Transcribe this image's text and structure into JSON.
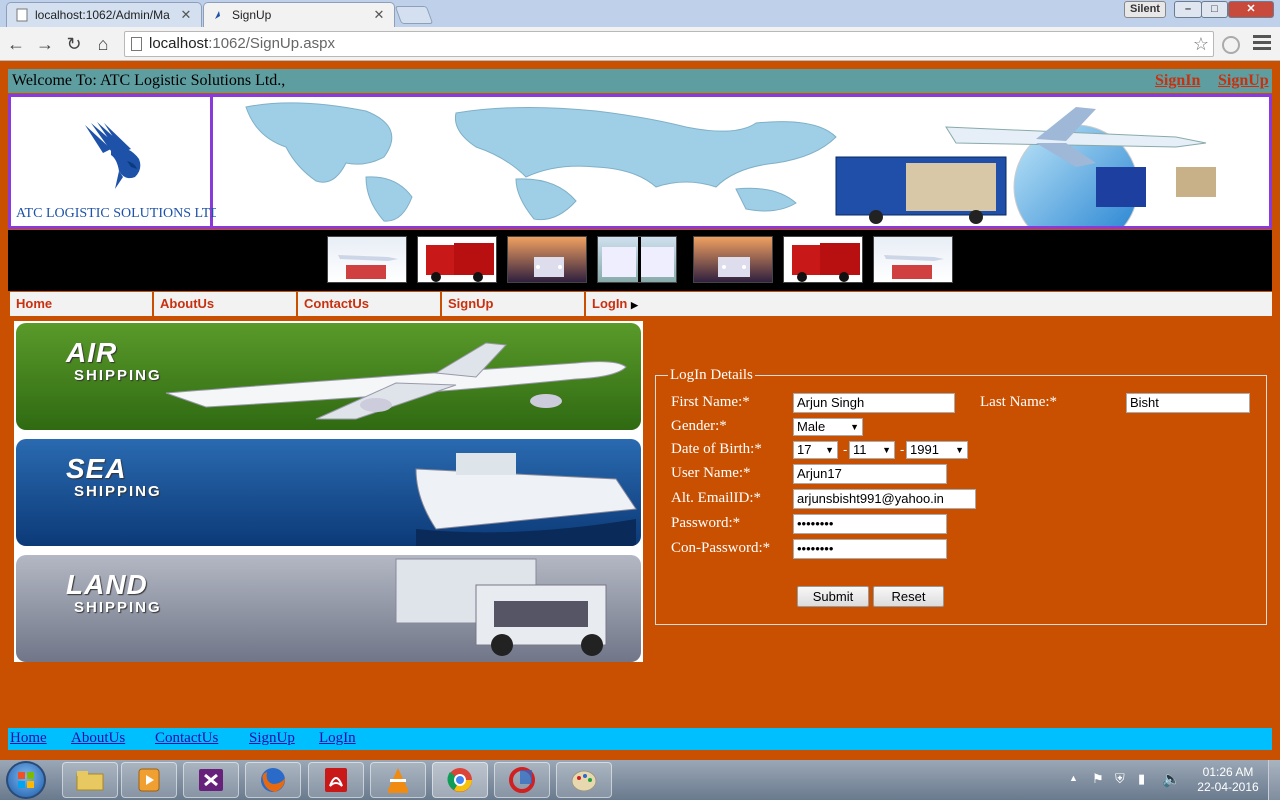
{
  "browser": {
    "tabs": [
      {
        "label": "localhost:1062/Admin/Ma"
      },
      {
        "label": "SignUp"
      }
    ],
    "address": {
      "host": "localhost",
      "path": ":1062/SignUp.aspx"
    },
    "profile_label": "Silent",
    "window_buttons": {
      "minimize": "–",
      "maximize": "□",
      "close": "✕"
    }
  },
  "header": {
    "welcome": "Welcome To: ATC Logistic Solutions Ltd.,",
    "signin": "SignIn",
    "signup": "SignUp",
    "logo_text": "ATC LOGISTIC SOLUTIONS LTD.,"
  },
  "menu": [
    {
      "label": "Home"
    },
    {
      "label": "AboutUs"
    },
    {
      "label": "ContactUs"
    },
    {
      "label": "SignUp"
    },
    {
      "label": "LogIn"
    }
  ],
  "shipping": [
    {
      "title": "AIR",
      "subtitle": "SHIPPING",
      "color": "#3f7a1c"
    },
    {
      "title": "SEA",
      "subtitle": "SHIPPING",
      "color": "#1c4f8c"
    },
    {
      "title": "LAND",
      "subtitle": "SHIPPING",
      "color": "#8a8fa0"
    }
  ],
  "form": {
    "legend": "LogIn Details",
    "first_name_label": "First Name:*",
    "first_name_value": "Arjun Singh",
    "last_name_label": "Last Name:*",
    "last_name_value": "Bisht",
    "gender_label": "Gender:*",
    "gender_value": "Male",
    "dob_label": "Date of Birth:*",
    "dob_day": "17",
    "dob_month": "11",
    "dob_year": "1991",
    "dob_sep": "-",
    "username_label": "User Name:*",
    "username_value": "Arjun17",
    "email_label": "Alt. EmailID:*",
    "email_value": "arjunsbisht991@yahoo.in",
    "password_label": "Password:*",
    "password_value": "••••••••",
    "confirm_label": "Con-Password:*",
    "confirm_value": "••••••••",
    "submit": "Submit",
    "reset": "Reset"
  },
  "footer": [
    {
      "label": "Home"
    },
    {
      "label": "AboutUs"
    },
    {
      "label": "ContactUs"
    },
    {
      "label": "SignUp"
    },
    {
      "label": "LogIn"
    }
  ],
  "taskbar": {
    "time": "01:26 AM",
    "date": "22-04-2016"
  },
  "colors": {
    "page_bg": "#c85000",
    "welcome_bar": "#5f9ea0",
    "footer_bar": "#00bfff",
    "banner_border": "#8a3ad8",
    "menu_text": "#c8310f"
  }
}
